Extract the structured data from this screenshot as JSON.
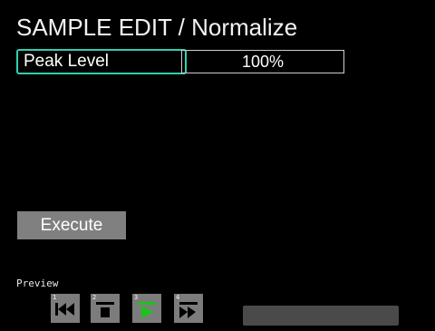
{
  "header": {
    "title": "SAMPLE EDIT / Normalize"
  },
  "parameter": {
    "label": "Peak Level",
    "value": "100%"
  },
  "actions": {
    "execute_label": "Execute"
  },
  "preview": {
    "label": "Preview",
    "buttons": [
      {
        "number": "1",
        "icon": "rewind-to-start-icon"
      },
      {
        "number": "2",
        "icon": "stop-icon"
      },
      {
        "number": "3",
        "icon": "play-icon",
        "active": true
      },
      {
        "number": "4",
        "icon": "fast-forward-icon"
      }
    ],
    "progress_fraction": 0
  },
  "colors": {
    "background": "#000000",
    "focus_border": "#2fd0b0",
    "button_gray": "#808080",
    "play_active": "#1ec21e"
  }
}
